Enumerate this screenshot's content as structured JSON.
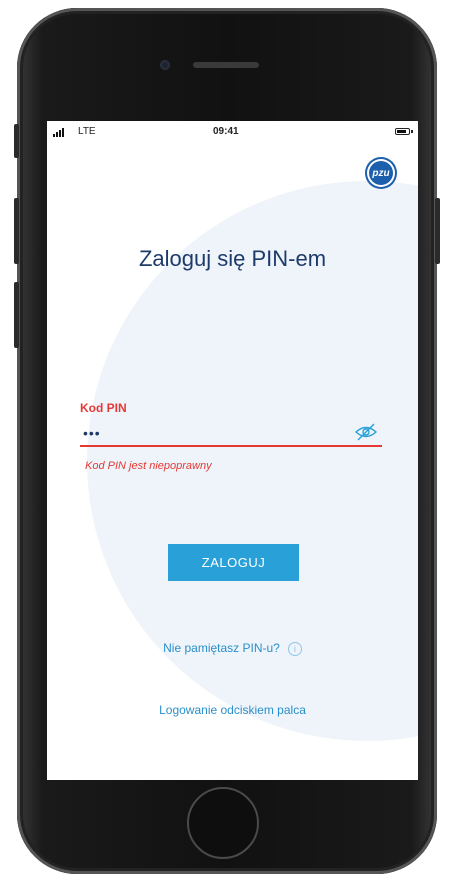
{
  "status_bar": {
    "network": "LTE",
    "time": "09:41"
  },
  "logo": {
    "text": "pzu",
    "icon": "pzu-logo-icon"
  },
  "title": "Zaloguj się PIN-em",
  "pin": {
    "label": "Kod PIN",
    "value": "•••",
    "error": "Kod PIN jest niepoprawny",
    "toggle_icon": "eye-slash-icon"
  },
  "login_button": "ZALOGUJ",
  "forgot_pin": {
    "label": "Nie pamiętasz PIN-u?",
    "icon": "info-icon",
    "icon_glyph": "i"
  },
  "fingerprint_login": "Logowanie odciskiem palca",
  "colors": {
    "accent": "#2aa0d8",
    "error": "#e53935",
    "title": "#1e3a6a",
    "link": "#2a8fcb",
    "brand": "#1b5fad"
  }
}
